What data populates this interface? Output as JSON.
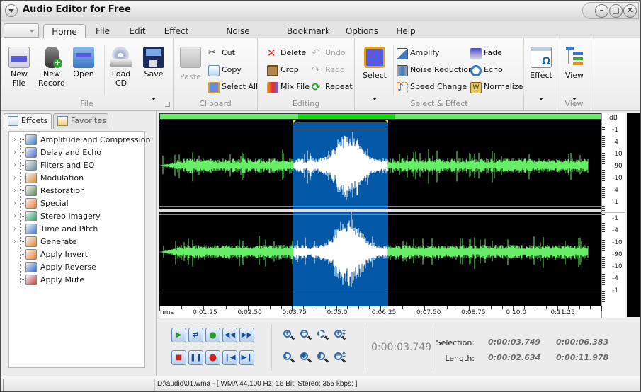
{
  "app": {
    "title": "Audio Editor for Free"
  },
  "ribbon_tabs": [
    {
      "label": "Home",
      "active": true
    },
    {
      "label": "File"
    },
    {
      "label": "Edit"
    },
    {
      "label": "Effect"
    },
    {
      "label": "Noise Reduction"
    },
    {
      "label": "Bookmark"
    },
    {
      "label": "Options"
    },
    {
      "label": "Help"
    }
  ],
  "ribbon": {
    "file_group": {
      "label": "File",
      "new_file": "New\nFile",
      "new_record": "New\nRecord",
      "open": "Open",
      "load_cd": "Load\nCD",
      "save": "Save"
    },
    "clipboard_group": {
      "label": "Cliboard",
      "paste": "Paste",
      "cut": "Cut",
      "copy": "Copy",
      "select_all": "Select All"
    },
    "editing_group": {
      "label": "Editing",
      "delete": "Delete",
      "crop": "Crop",
      "mix_file": "Mix File",
      "undo": "Undo",
      "redo": "Redo",
      "repeat": "Repeat"
    },
    "select_effect_group": {
      "label": "Select & Effect",
      "select": "Select",
      "amplify": "Amplify",
      "noise_reduction": "Noise Reduction",
      "speed_change": "Speed Change",
      "fade": "Fade",
      "echo": "Echo",
      "normalize": "Normalize",
      "effect": "Effect"
    },
    "view_group": {
      "label": "View",
      "view": "View"
    }
  },
  "left_panel": {
    "tabs": [
      {
        "label": "Effcets",
        "active": true
      },
      {
        "label": "Favorites"
      }
    ],
    "tree": [
      {
        "label": "Amplitude and Compression",
        "expandable": true,
        "icon": "amplitude-icon"
      },
      {
        "label": "Delay and Echo",
        "expandable": true,
        "icon": "delay-icon"
      },
      {
        "label": "Filters and EQ",
        "expandable": true,
        "icon": "filters-icon"
      },
      {
        "label": "Modulation",
        "expandable": true,
        "icon": "modulation-icon"
      },
      {
        "label": "Restoration",
        "expandable": true,
        "icon": "restoration-icon"
      },
      {
        "label": "Special",
        "expandable": true,
        "icon": "special-icon"
      },
      {
        "label": "Stereo Imagery",
        "expandable": true,
        "icon": "stereo-icon"
      },
      {
        "label": "Time and Pitch",
        "expandable": true,
        "icon": "time-pitch-icon"
      },
      {
        "label": "Generate",
        "expandable": true,
        "icon": "generate-icon"
      },
      {
        "label": "Apply Invert",
        "expandable": false,
        "icon": "invert-icon"
      },
      {
        "label": "Apply Reverse",
        "expandable": false,
        "icon": "reverse-icon"
      },
      {
        "label": "Apply Mute",
        "expandable": false,
        "icon": "mute-icon"
      }
    ]
  },
  "waveform": {
    "db_label": "dB",
    "db_ticks": [
      "-1",
      "-4",
      "-10",
      "-90",
      "-10",
      "-4",
      "-1"
    ],
    "timeline_unit": "hms",
    "timeline_labels": [
      "0:01.25",
      "0:02.50",
      "0:03.75",
      "0:05.0",
      "0:06.25",
      "0:07.50",
      "0:08.75",
      "0:10.0",
      "0:11.25"
    ],
    "selection_start_s": 3.749,
    "selection_end_s": 6.383,
    "total_length_s": 11.978,
    "colors": {
      "wave": "#66ee66",
      "selected_wave": "#ffffff",
      "selection_bg": "#0458a8",
      "background": "#000000"
    }
  },
  "transport": {
    "current_time": "0:00:03.749",
    "selection_label": "Selection:",
    "length_label": "Length:",
    "selection_start": "0:00:03.749",
    "selection_end": "0:00:06.383",
    "selection_length": "0:00:02.634",
    "total_length": "0:00:11.978"
  },
  "status": {
    "text": "D:\\audio\\01.wma - [ WMA 44,100 Hz; 16 Bit; Stereo; 355 kbps; ]"
  }
}
